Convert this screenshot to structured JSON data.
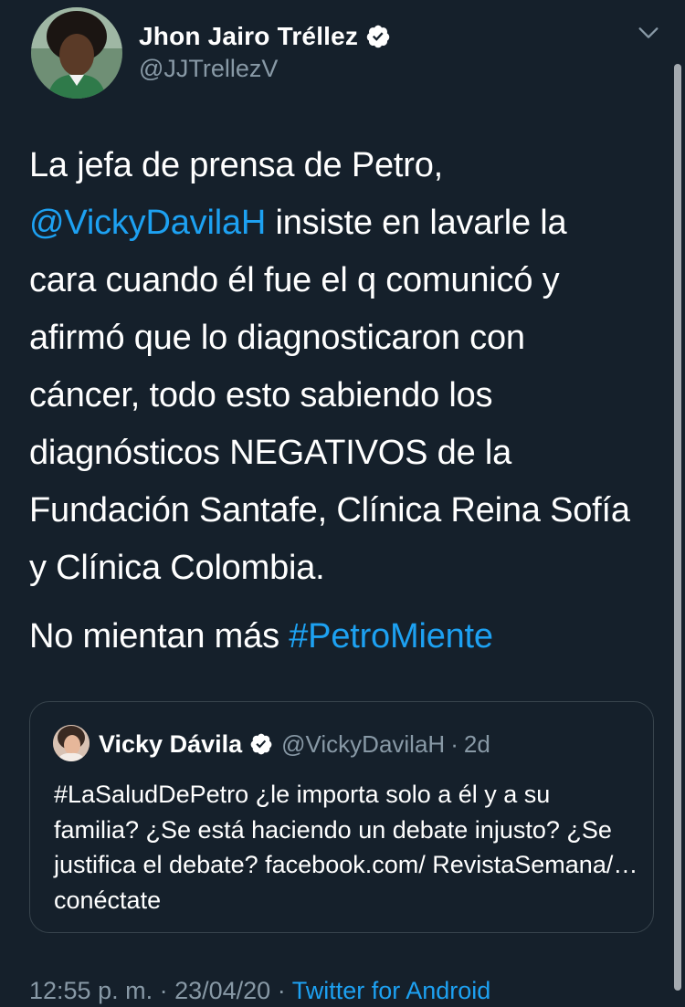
{
  "author": {
    "display_name": "Jhon Jairo Tréllez",
    "handle": "@JJTrellezV",
    "verified": true
  },
  "tweet": {
    "paragraph1": {
      "text_before": "La jefa de prensa de Petro, ",
      "mention": "@VickyDavilaH",
      "text_after": " insiste en lavarle la cara cuando él fue el q comunicó y afirmó que lo diagnosticaron con cáncer, todo esto sabiendo los diagnósticos NEGATIVOS de la Fundación Santafe, Clínica Reina Sofía y Clínica Colombia."
    },
    "paragraph2": {
      "text_before": "No mientan más ",
      "hashtag": "#PetroMiente"
    }
  },
  "quoted_tweet": {
    "display_name": "Vicky Dávila",
    "handle": "@VickyDavilaH",
    "separator": "·",
    "time": "2d",
    "text": "#LaSaludDePetro  ¿le importa solo a él y a su familia? ¿Se está haciendo un debate injusto? ¿Se justifica el debate?  facebook.com/ RevistaSemana/… conéctate"
  },
  "meta": {
    "time": "12:55 p. m.",
    "sep1": " · ",
    "date": "23/04/20",
    "sep2": " · ",
    "source": "Twitter for Android"
  },
  "icons": {
    "verified": "verified-badge-icon",
    "more": "chevron-down-icon"
  },
  "colors": {
    "background": "#15202b",
    "link": "#1da1f2",
    "secondary_text": "#8899a6",
    "border": "#38444d"
  }
}
